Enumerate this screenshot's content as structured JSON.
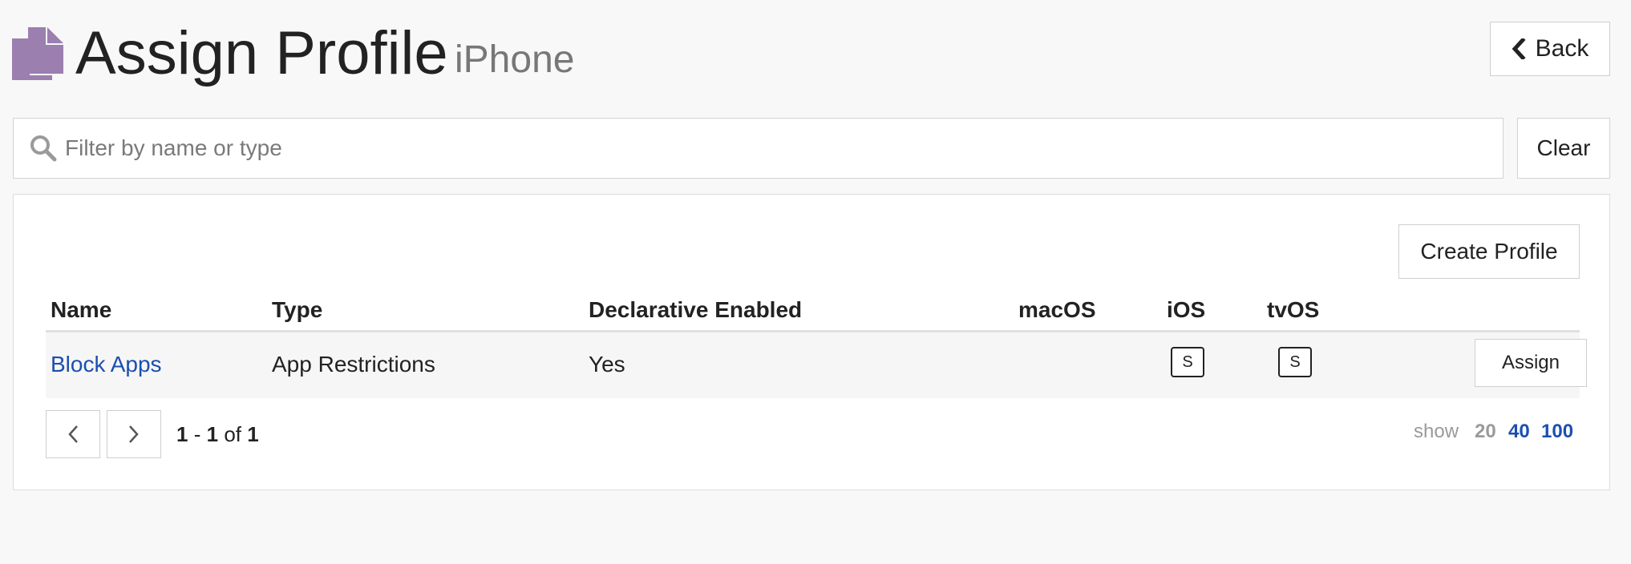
{
  "header": {
    "title": "Assign Profile",
    "subtitle": "iPhone",
    "back_label": "Back",
    "icon": "profile-documents-icon",
    "icon_color": "#9b7fae"
  },
  "search": {
    "placeholder": "Filter by name or type",
    "value": "",
    "clear_label": "Clear"
  },
  "panel": {
    "create_label": "Create Profile"
  },
  "table": {
    "columns": [
      "Name",
      "Type",
      "Declarative Enabled",
      "macOS",
      "iOS",
      "tvOS"
    ],
    "rows": [
      {
        "name": "Block Apps",
        "type": "App Restrictions",
        "declarative": "Yes",
        "macos": "",
        "ios": "S",
        "tvos": "S",
        "action": "Assign"
      }
    ]
  },
  "pagination": {
    "start": "1",
    "end": "1",
    "total": "1",
    "sep": "-",
    "of": "of",
    "show_label": "show",
    "options": [
      "20",
      "40",
      "100"
    ],
    "selected": "20"
  },
  "colors": {
    "link": "#1b4fb0",
    "muted": "#9a9a9a",
    "background": "#f8f8f8"
  }
}
